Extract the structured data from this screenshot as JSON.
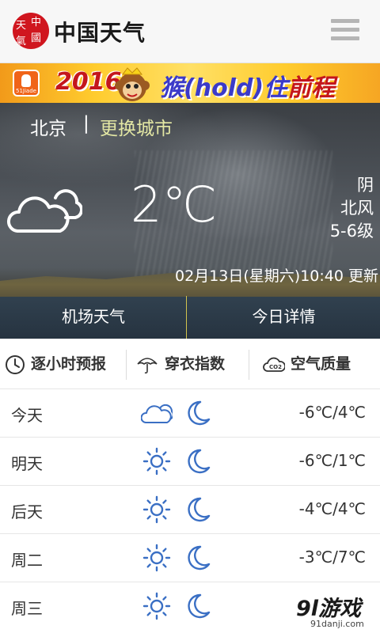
{
  "header": {
    "logo_seal_text": "中国天气",
    "title": "中国天气",
    "menu_icon": "hamburger-menu-icon"
  },
  "banner": {
    "app_badge": "51Jiade",
    "year": "2016",
    "slogan_part1": "猴(hold)住",
    "slogan_part2": "前程",
    "mascot": "monkey-icon"
  },
  "location": {
    "city": "北京",
    "separator": "|",
    "change_city": "更换城市"
  },
  "current": {
    "temperature": "2℃",
    "condition": "阴",
    "wind_direction": "北风",
    "wind_level": "5-6级",
    "icon": "cloudy-icon",
    "update_time": "02月13日(星期六)10:40 更新"
  },
  "hero_tabs": {
    "airport": "机场天气",
    "today_detail": "今日详情"
  },
  "sub_tabs": [
    {
      "label": "逐小时预报",
      "icon": "clock-icon"
    },
    {
      "label": "穿衣指数",
      "icon": "umbrella-icon"
    },
    {
      "label": "空气质量",
      "icon": "co2-cloud-icon"
    }
  ],
  "forecast": [
    {
      "day": "今天",
      "day_icon": "cloudy-icon",
      "night_icon": "moon-icon",
      "range": "-6℃/4℃"
    },
    {
      "day": "明天",
      "day_icon": "sun-icon",
      "night_icon": "moon-icon",
      "range": "-6℃/1℃"
    },
    {
      "day": "后天",
      "day_icon": "sun-icon",
      "night_icon": "moon-icon",
      "range": "-4℃/4℃"
    },
    {
      "day": "周二",
      "day_icon": "sun-icon",
      "night_icon": "moon-icon",
      "range": "-3℃/7℃"
    },
    {
      "day": "周三",
      "day_icon": "sun-icon",
      "night_icon": "moon-icon",
      "range": ""
    }
  ],
  "watermark": {
    "logo": "9l游戏",
    "url": "91danji.com"
  },
  "colors": {
    "icon_blue": "#3a6fc4",
    "change_city": "#e3e7a4",
    "divider_gold": "#d2c44e"
  }
}
